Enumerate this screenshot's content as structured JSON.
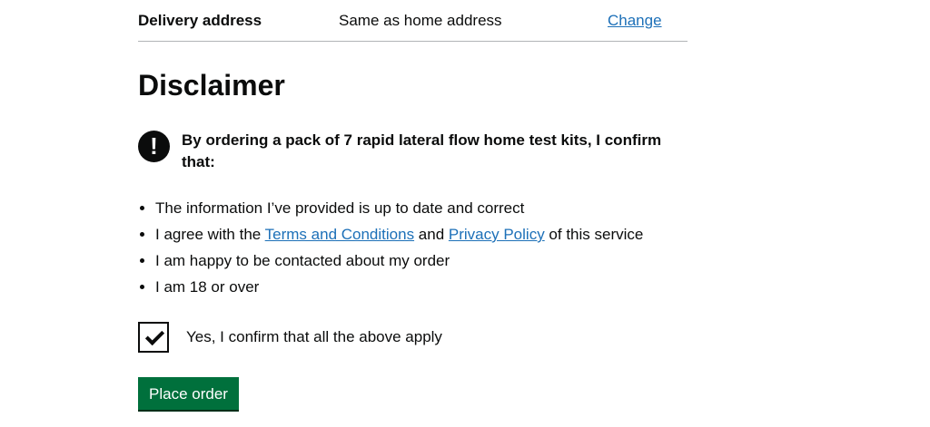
{
  "summary": {
    "key": "Delivery address",
    "value": "Same as home address",
    "action": "Change"
  },
  "heading": "Disclaimer",
  "warning": {
    "icon": "!",
    "text": "By ordering a pack of 7 rapid lateral flow home test kits, I confirm that:"
  },
  "bullets": {
    "item1": "The information I’ve provided is up to date and correct",
    "item2_prefix": "I agree with the ",
    "terms_link": "Terms and Conditions",
    "item2_middle": " and ",
    "privacy_link": "Privacy Policy",
    "item2_suffix": " of this service",
    "item3": "I am happy to be contacted about my order",
    "item4": "I am 18 or over"
  },
  "confirm_checkbox": {
    "label": "Yes, I confirm that all the above apply",
    "checked": true
  },
  "place_order_button": "Place order",
  "colors": {
    "link": "#1d70b8",
    "button": "#00703c",
    "text": "#0b0c0c",
    "border": "#b1b4b6"
  }
}
